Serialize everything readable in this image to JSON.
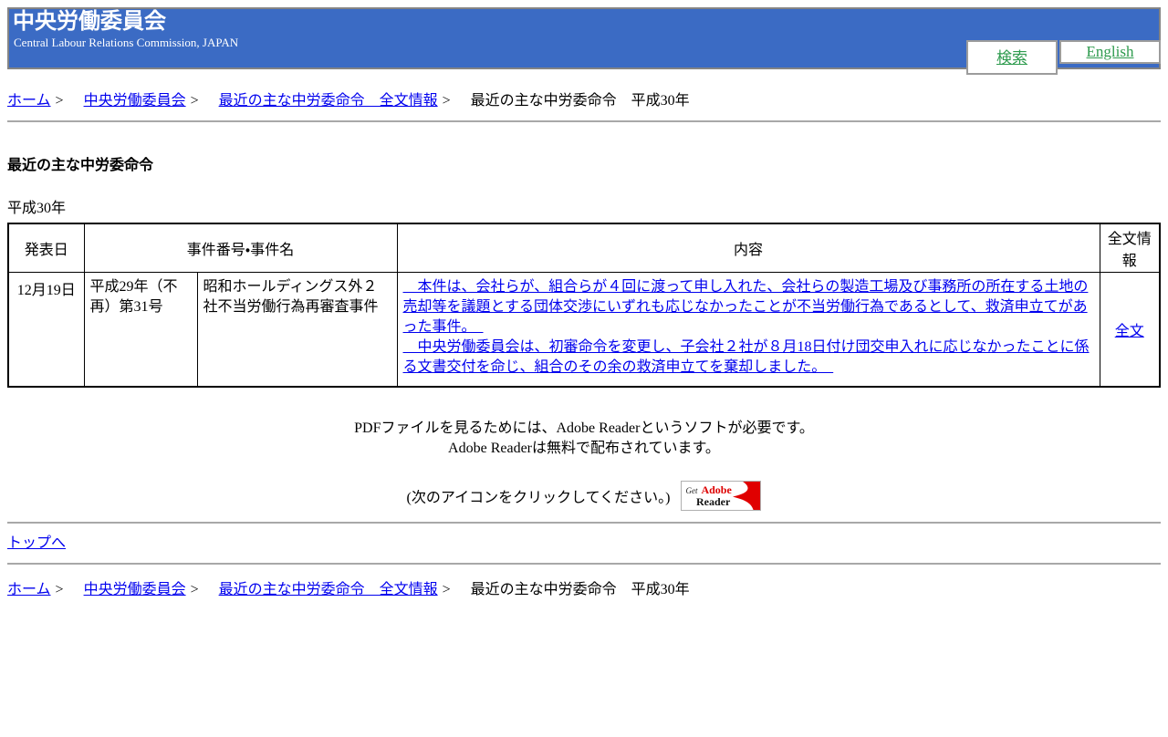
{
  "colors": {
    "banner_blue": "#3b6bc4",
    "link_blue": "#0000ee",
    "link_green": "#2e9b4e",
    "adobe_red": "#dd0000"
  },
  "banner": {
    "title": "中央労働委員会",
    "subtitle": "Central Labour Relations Commission, JAPAN",
    "search_label": "検索",
    "english_label": "English"
  },
  "breadcrumb": {
    "separator": ">",
    "items": [
      {
        "label": "ホーム"
      },
      {
        "label": "中央労働委員会"
      },
      {
        "label": "最近の主な中労委命令　全文情報"
      },
      {
        "label": "最近の主な中労委命令　平成30年"
      }
    ]
  },
  "page": {
    "heading": "最近の主な中労委命令",
    "era_label": "平成30年"
  },
  "table": {
    "headers": {
      "date": "発表日",
      "case": "事件番号・事件名",
      "summary": "内容",
      "fulltext": "全文情報"
    },
    "rows": [
      {
        "date": "12月19日",
        "case_number": "平成29年（不再）第31号",
        "case_name": "昭和ホールディングス外２社不当労働行為再審査事件",
        "summary_paragraphs": [
          "　本件は、会社らが、組合らが４回に渡って申し入れた、会社らの製造工場及び事務所の所在する土地の売却等を議題とする団体交渉にいずれも応じなかったことが不当労働行為であるとして、救済申立てがあった事件。　",
          "　中央労働委員会は、初審命令を変更し、子会社２社が８月18日付け団交申入れに応じなかったことに係る文書交付を命じ、組合のその余の救済申立てを棄却しました。　"
        ],
        "fulltext_label": "全文"
      }
    ]
  },
  "pdf_note": {
    "line1": "PDFファイルを見るためには、Adobe Readerというソフトが必要です。",
    "line2": "Adobe Readerは無料で配布されています。",
    "line3": "(次のアイコンをクリックしてください。)",
    "badge": {
      "get": "Get",
      "adobe": "Adobe",
      "reader": "Reader"
    }
  },
  "footer": {
    "top_link": "トップへ"
  }
}
